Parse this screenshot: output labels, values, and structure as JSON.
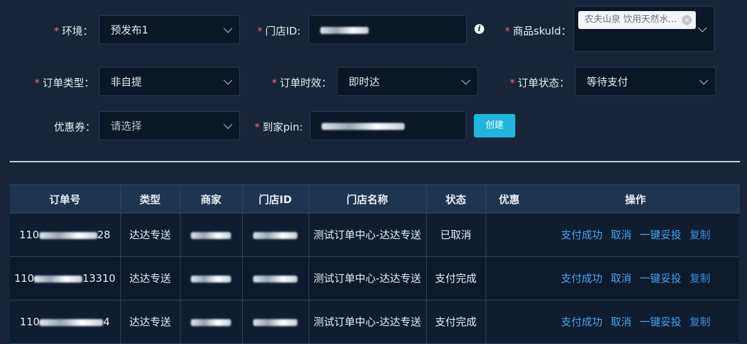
{
  "form": {
    "env": {
      "label": "环境：",
      "value": "预发布1"
    },
    "store_id": {
      "label": "门店ID:"
    },
    "sku": {
      "label": "商品skuId：",
      "tag": "农夫山泉 饮用天然水...",
      "tag_close": "×"
    },
    "order_type": {
      "label": "订单类型：",
      "value": "非自提"
    },
    "order_time": {
      "label": "订单时效：",
      "value": "即时达"
    },
    "order_status": {
      "label": "订单状态：",
      "value": "等待支付"
    },
    "coupon": {
      "label": "优惠券：",
      "placeholder": "请选择"
    },
    "pin": {
      "label": "到家pin:"
    },
    "create_button": "创建",
    "required_mark": "*",
    "info_glyph": "i"
  },
  "table": {
    "headers": [
      "订单号",
      "类型",
      "商家",
      "门店ID",
      "门店名称",
      "状态",
      "优惠",
      "操作"
    ],
    "rows": [
      {
        "order_no": "110\u0000\u0000\u0000\u0000\u0000\u0000\u0000\u0000\u0000\u0000\u000028",
        "type": "达达专送",
        "store_name": "测试订单中心-达达专送",
        "status": "已取消"
      },
      {
        "order_no": "110\u0000\u0000\u0000\u0000\u0000\u0000\u0000\u0000\u000013310",
        "type": "达达专送",
        "store_name": "测试订单中心-达达专送",
        "status": "支付完成"
      },
      {
        "order_no": "110\u0000\u0000\u0000\u0000\u0000\u0000\u0000\u0000\u0000\u00004",
        "type": "达达专送",
        "store_name": "测试订单中心-达达专送",
        "status": "支付完成"
      }
    ],
    "actions": [
      "支付成功",
      "取消",
      "一键妥投",
      "复制"
    ]
  },
  "colors": {
    "background": "#17243a",
    "required": "#f56c6c",
    "primary_button": "#1fb5dd",
    "link": "#4aa3ea"
  }
}
